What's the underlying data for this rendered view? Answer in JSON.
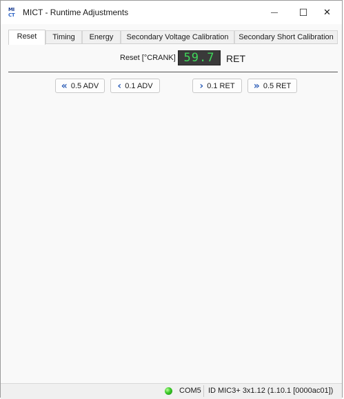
{
  "window": {
    "title": "MICT - Runtime Adjustments",
    "icon_text_top": "MI",
    "icon_text_bottom": "CT",
    "minimize_glyph": "—",
    "maximize_glyph": "☐",
    "close_glyph": "✕"
  },
  "tabs": [
    {
      "label": "Reset",
      "active": true
    },
    {
      "label": "Timing",
      "active": false
    },
    {
      "label": "Energy",
      "active": false
    },
    {
      "label": "Secondary Voltage Calibration",
      "active": false
    },
    {
      "label": "Secondary Short Calibration",
      "active": false
    }
  ],
  "reset": {
    "label": "Reset [°CRANK]",
    "value": "59.7",
    "unit": "RET"
  },
  "buttons": {
    "adv_05": {
      "label": "0.5 ADV",
      "icon": "double-chevron-left-icon"
    },
    "adv_01": {
      "label": "0.1 ADV",
      "icon": "chevron-left-icon"
    },
    "ret_01": {
      "label": "0.1 RET",
      "icon": "chevron-right-icon"
    },
    "ret_05": {
      "label": "0.5 RET",
      "icon": "double-chevron-right-icon"
    }
  },
  "status": {
    "port": "COM5",
    "id": "ID MIC3+ 3x1.12 (1.10.1 [0000ac01])",
    "led_color": "#39c728"
  },
  "colors": {
    "lcd_background": "#3a3a3a",
    "lcd_text": "#3fd85a",
    "chevron": "#2f5fb8"
  }
}
